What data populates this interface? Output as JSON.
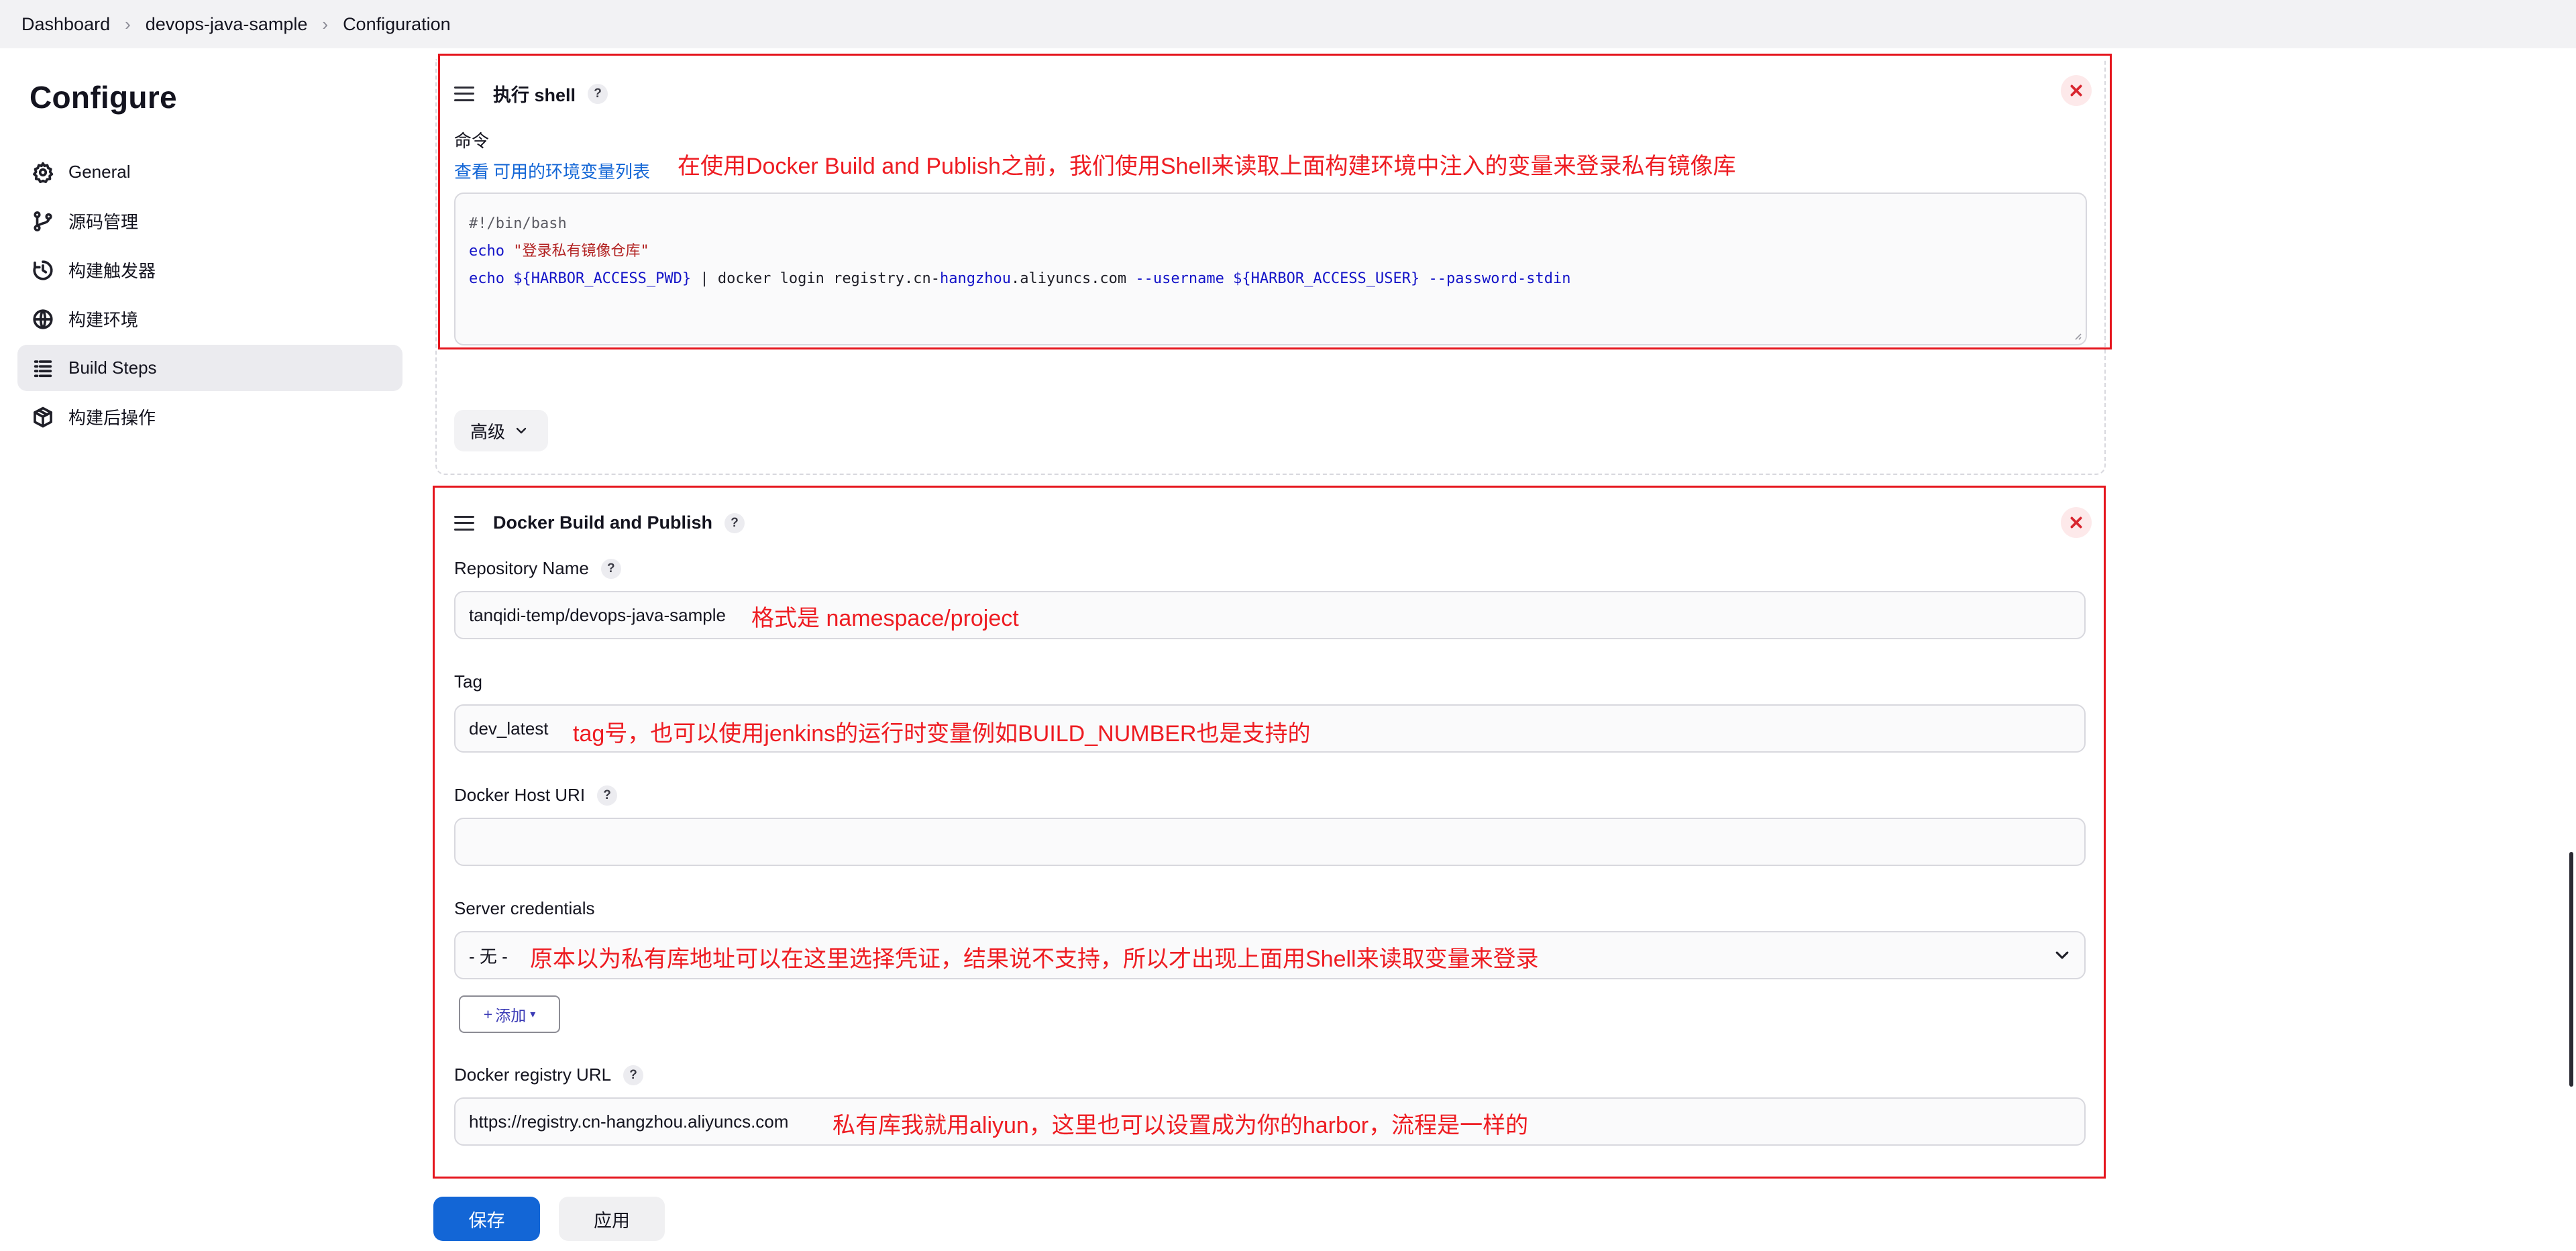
{
  "breadcrumb": [
    "Dashboard",
    "devops-java-sample",
    "Configuration"
  ],
  "page_title": "Configure",
  "sidebar": {
    "items": [
      {
        "label": "General",
        "icon": "gear-icon"
      },
      {
        "label": "源码管理",
        "icon": "git-branch-icon"
      },
      {
        "label": "构建触发器",
        "icon": "timer-icon"
      },
      {
        "label": "构建环境",
        "icon": "globe-icon"
      },
      {
        "label": "Build Steps",
        "icon": "list-icon",
        "active": true
      },
      {
        "label": "构建后操作",
        "icon": "package-icon"
      }
    ]
  },
  "shell_step": {
    "title": "执行 shell",
    "help": "?",
    "command_label": "命令",
    "env_link_prefix": "查看",
    "env_link": "可用的环境变量列表",
    "annotation": "在使用Docker Build and Publish之前，我们使用Shell来读取上面构建环境中注入的变量来登录私有镜像库",
    "code": {
      "line1": "#!/bin/bash",
      "line2_kw": "echo",
      "line2_str": "\"登录私有镜像仓库\"",
      "line3_kw": "echo",
      "line3_var1": "${HARBOR_ACCESS_PWD}",
      "line3_txt1": "| docker login registry.cn-",
      "line3_host": "hangzhou",
      "line3_txt2": ".aliyuncs.com",
      "line3_flag1": "--username",
      "line3_var2": "${HARBOR_ACCESS_USER}",
      "line3_flag2": "--password-stdin"
    },
    "advanced_label": "高级"
  },
  "docker_step": {
    "title": "Docker Build and Publish",
    "help": "?",
    "repo_label": "Repository Name",
    "repo_value": "tanqidi-temp/devops-java-sample",
    "repo_annotation": "格式是  namespace/project",
    "tag_label": "Tag",
    "tag_value": "dev_latest",
    "tag_annotation": "tag号，也可以使用jenkins的运行时变量例如BUILD_NUMBER也是支持的",
    "host_label": "Docker Host URI",
    "host_value": "",
    "cred_label": "Server credentials",
    "cred_value": "- 无 -",
    "cred_annotation": "原本以为私有库地址可以在这里选择凭证，结果说不支持，所以才出现上面用Shell来读取变量来登录",
    "add_label": "添加",
    "registry_label": "Docker registry URL",
    "registry_value": "https://registry.cn-hangzhou.aliyuncs.com",
    "registry_annotation": "私有库我就用aliyun，这里也可以设置成为你的harbor，流程是一样的"
  },
  "footer": {
    "save_label": "保存",
    "apply_label": "应用"
  },
  "colors": {
    "annotation": "#ee1c22",
    "primary": "#1366d6",
    "link": "#1366d6"
  }
}
